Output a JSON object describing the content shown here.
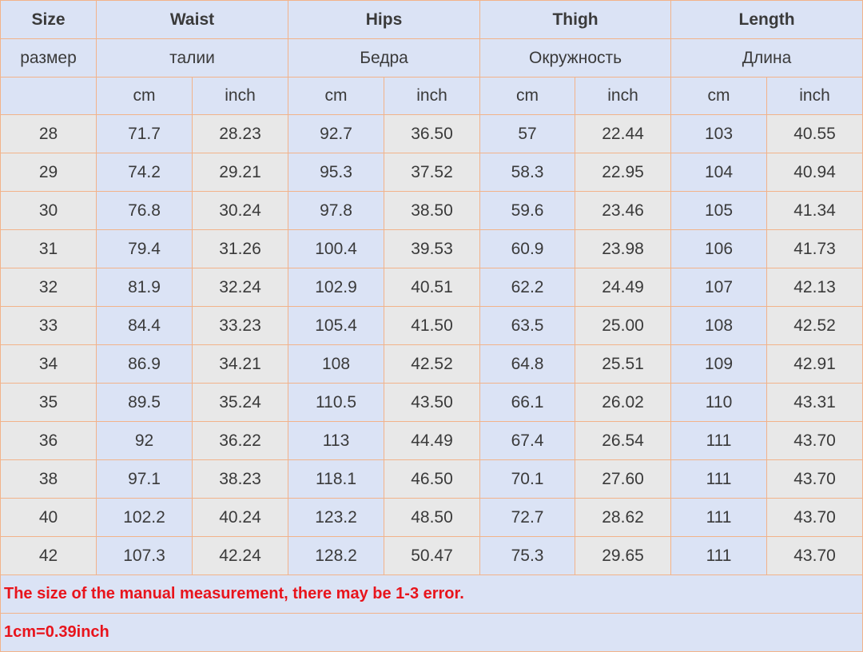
{
  "headers": {
    "size": "Size",
    "waist": "Waist",
    "hips": "Hips",
    "thigh": "Thigh",
    "length": "Length"
  },
  "russian_headers": {
    "size": "размер",
    "waist": "талии",
    "hips": "Бедра",
    "thigh": "Окружность",
    "length": "Длина"
  },
  "units": {
    "cm": "cm",
    "inch": "inch"
  },
  "rows": [
    [
      "28",
      "71.7",
      "28.23",
      "92.7",
      "36.50",
      "57",
      "22.44",
      "103",
      "40.55"
    ],
    [
      "29",
      "74.2",
      "29.21",
      "95.3",
      "37.52",
      "58.3",
      "22.95",
      "104",
      "40.94"
    ],
    [
      "30",
      "76.8",
      "30.24",
      "97.8",
      "38.50",
      "59.6",
      "23.46",
      "105",
      "41.34"
    ],
    [
      "31",
      "79.4",
      "31.26",
      "100.4",
      "39.53",
      "60.9",
      "23.98",
      "106",
      "41.73"
    ],
    [
      "32",
      "81.9",
      "32.24",
      "102.9",
      "40.51",
      "62.2",
      "24.49",
      "107",
      "42.13"
    ],
    [
      "33",
      "84.4",
      "33.23",
      "105.4",
      "41.50",
      "63.5",
      "25.00",
      "108",
      "42.52"
    ],
    [
      "34",
      "86.9",
      "34.21",
      "108",
      "42.52",
      "64.8",
      "25.51",
      "109",
      "42.91"
    ],
    [
      "35",
      "89.5",
      "35.24",
      "110.5",
      "43.50",
      "66.1",
      "26.02",
      "110",
      "43.31"
    ],
    [
      "36",
      "92",
      "36.22",
      "113",
      "44.49",
      "67.4",
      "26.54",
      "111",
      "43.70"
    ],
    [
      "38",
      "97.1",
      "38.23",
      "118.1",
      "46.50",
      "70.1",
      "27.60",
      "111",
      "43.70"
    ],
    [
      "40",
      "102.2",
      "40.24",
      "123.2",
      "48.50",
      "72.7",
      "28.62",
      "111",
      "43.70"
    ],
    [
      "42",
      "107.3",
      "42.24",
      "128.2",
      "50.47",
      "75.3",
      "29.65",
      "111",
      "43.70"
    ]
  ],
  "notes": {
    "error": "The size of the manual measurement, there may be 1-3 error.",
    "conversion": "1cm=0.39inch"
  },
  "colors": {
    "header_bg": "#dbe3f5",
    "alt_bg": "#e8e8e8",
    "border": "#f2b38a",
    "note_text": "#e8141c"
  }
}
